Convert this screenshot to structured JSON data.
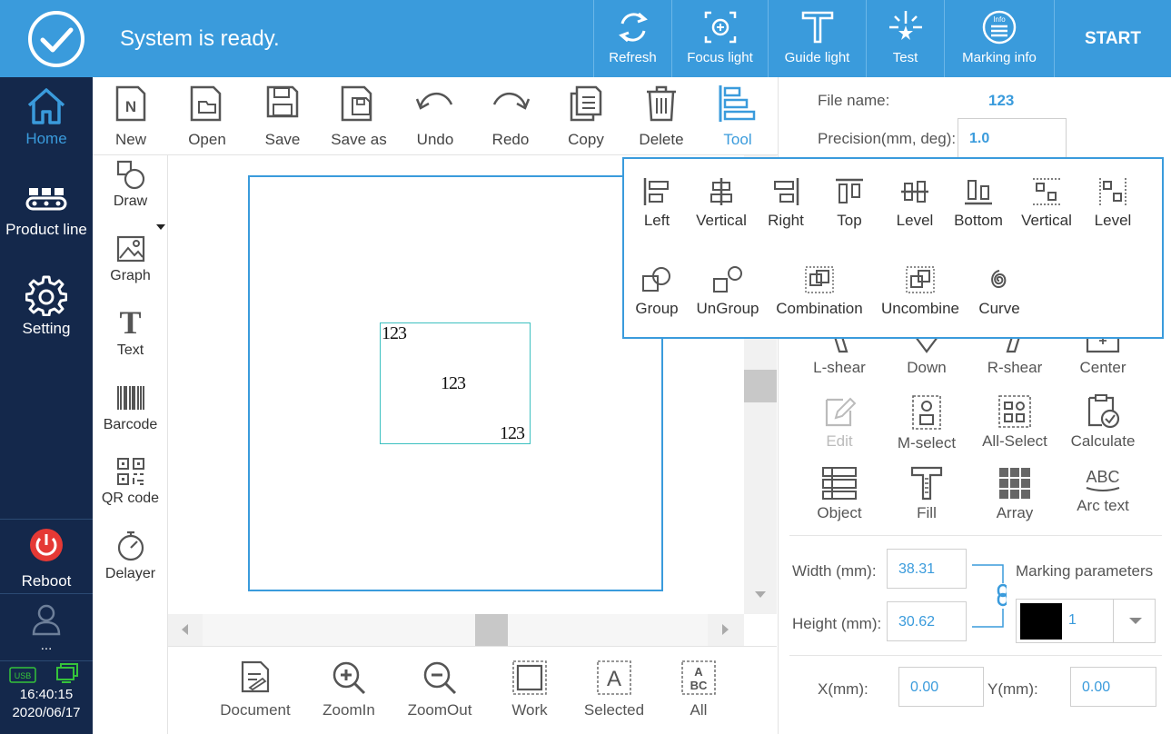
{
  "header": {
    "status_text": "System is ready.",
    "buttons": [
      {
        "label": "Refresh",
        "icon": "refresh-icon"
      },
      {
        "label": "Focus light",
        "icon": "focus-light-icon"
      },
      {
        "label": "Guide light",
        "icon": "guide-light-icon"
      },
      {
        "label": "Test",
        "icon": "test-icon"
      },
      {
        "label": "Marking info",
        "icon": "info-icon"
      }
    ],
    "start_label": "START",
    "info_glyph": "Info"
  },
  "sidebar": {
    "items": [
      {
        "label": "Home",
        "icon": "home-icon"
      },
      {
        "label": "Product line",
        "icon": "product-line-icon"
      },
      {
        "label": "Setting",
        "icon": "gear-icon"
      }
    ],
    "reboot_label": "Reboot",
    "user_label": "...",
    "usb_label": "USB",
    "time": "16:40:15",
    "date": "2020/06/17"
  },
  "toolbar": {
    "buttons": [
      {
        "label": "New",
        "icon": "new-file-icon"
      },
      {
        "label": "Open",
        "icon": "open-folder-icon"
      },
      {
        "label": "Save",
        "icon": "save-icon"
      },
      {
        "label": "Save as",
        "icon": "save-as-icon"
      },
      {
        "label": "Undo",
        "icon": "undo-icon"
      },
      {
        "label": "Redo",
        "icon": "redo-icon"
      },
      {
        "label": "Copy",
        "icon": "copy-icon"
      },
      {
        "label": "Delete",
        "icon": "trash-icon"
      },
      {
        "label": "Tool",
        "icon": "align-tool-icon"
      }
    ],
    "new_glyph": "N"
  },
  "palette": {
    "items": [
      {
        "label": "Draw",
        "icon": "draw-shapes-icon"
      },
      {
        "label": "Graph",
        "icon": "image-icon"
      },
      {
        "label": "Text",
        "icon": "text-icon"
      },
      {
        "label": "Barcode",
        "icon": "barcode-icon"
      },
      {
        "label": "QR code",
        "icon": "qr-code-icon"
      },
      {
        "label": "Delayer",
        "icon": "timer-icon"
      }
    ],
    "text_glyph": "T"
  },
  "canvas": {
    "object_texts": [
      "123",
      "123",
      "123"
    ]
  },
  "viewbar": {
    "buttons": [
      {
        "label": "Document",
        "icon": "document-icon"
      },
      {
        "label": "ZoomIn",
        "icon": "zoom-in-icon"
      },
      {
        "label": "ZoomOut",
        "icon": "zoom-out-icon"
      },
      {
        "label": "Work",
        "icon": "work-area-icon"
      },
      {
        "label": "Selected",
        "icon": "selected-icon"
      },
      {
        "label": "All",
        "icon": "select-all-icon"
      }
    ],
    "selected_glyph": "A",
    "all_glyph_top": "A",
    "all_glyph_bottom": "BC"
  },
  "right_panel": {
    "file_name_label": "File name:",
    "file_name_value": "123",
    "precision_label": "Precision(mm, deg):",
    "precision_value": "1.0",
    "transform_buttons": [
      {
        "label": "L-shear",
        "icon": "left-shear-icon",
        "enabled": true
      },
      {
        "label": "Down",
        "icon": "down-icon",
        "enabled": true
      },
      {
        "label": "R-shear",
        "icon": "right-shear-icon",
        "enabled": true
      },
      {
        "label": "Center",
        "icon": "center-icon",
        "enabled": true
      },
      {
        "label": "Edit",
        "icon": "edit-icon",
        "enabled": false
      },
      {
        "label": "M-select",
        "icon": "multi-select-icon",
        "enabled": true
      },
      {
        "label": "All-Select",
        "icon": "all-select-icon",
        "enabled": true
      },
      {
        "label": "Calculate",
        "icon": "calculate-icon",
        "enabled": true
      },
      {
        "label": "Object",
        "icon": "object-list-icon",
        "enabled": true
      },
      {
        "label": "Fill",
        "icon": "fill-icon",
        "enabled": true
      },
      {
        "label": "Array",
        "icon": "array-icon",
        "enabled": true
      },
      {
        "label": "Arc text",
        "icon": "arc-text-icon",
        "enabled": true
      }
    ],
    "arc_text_glyph": "ABC",
    "width_label": "Width (mm):",
    "width_value": "38.31",
    "height_label": "Height (mm):",
    "height_value": "30.62",
    "marking_params_label": "Marking parameters",
    "marking_color": "#000000",
    "marking_param_value": "1",
    "x_label": "X(mm):",
    "x_value": "0.00",
    "y_label": "Y(mm):",
    "y_value": "0.00"
  },
  "tool_popup": {
    "row1": [
      {
        "label": "Left",
        "icon": "align-left-icon"
      },
      {
        "label": "Vertical",
        "icon": "align-vertical-center-icon"
      },
      {
        "label": "Right",
        "icon": "align-right-icon"
      },
      {
        "label": "Top",
        "icon": "align-top-icon"
      },
      {
        "label": "Level",
        "icon": "align-horizontal-center-icon"
      },
      {
        "label": "Bottom",
        "icon": "align-bottom-icon"
      },
      {
        "label": "Vertical",
        "icon": "distribute-vertical-icon"
      },
      {
        "label": "Level",
        "icon": "distribute-horizontal-icon"
      }
    ],
    "row2": [
      {
        "label": "Group",
        "icon": "group-icon"
      },
      {
        "label": "UnGroup",
        "icon": "ungroup-icon"
      },
      {
        "label": "Combination",
        "icon": "combine-icon"
      },
      {
        "label": "Uncombine",
        "icon": "uncombine-icon"
      },
      {
        "label": "Curve",
        "icon": "curve-icon"
      }
    ]
  },
  "colors": {
    "accent": "#3a9bdc",
    "sidebar_bg": "#14284b",
    "reboot_red": "#e53935",
    "usb_green": "#35c33a"
  }
}
